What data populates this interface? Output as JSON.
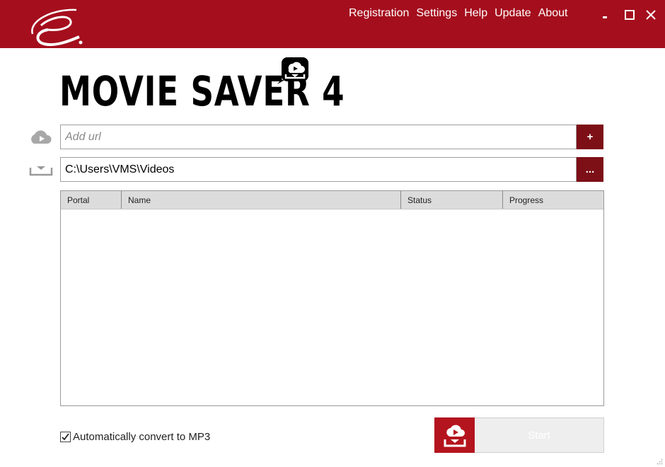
{
  "app": {
    "brand_title": "MOVIE SAVER 4"
  },
  "menu": {
    "items": [
      "Registration",
      "Settings",
      "Help",
      "Update",
      "About"
    ]
  },
  "window_controls": [
    "minimize-icon",
    "maximize-icon",
    "close-icon"
  ],
  "url": {
    "placeholder": "Add url",
    "value": "",
    "add_button": "+"
  },
  "folder": {
    "path": "C:\\Users\\VMS\\Videos",
    "browse_button": "..."
  },
  "table": {
    "columns": [
      "Portal",
      "Name",
      "Status",
      "Progress"
    ],
    "rows": []
  },
  "options": {
    "convert_mp3_label": "Automatically convert to MP3",
    "convert_mp3_checked": true
  },
  "start": {
    "label": "Start",
    "enabled": false
  },
  "colors": {
    "titlebar": "#a50e1d",
    "button_dark": "#7d0f17",
    "start_icon_bg": "#b4141e"
  }
}
